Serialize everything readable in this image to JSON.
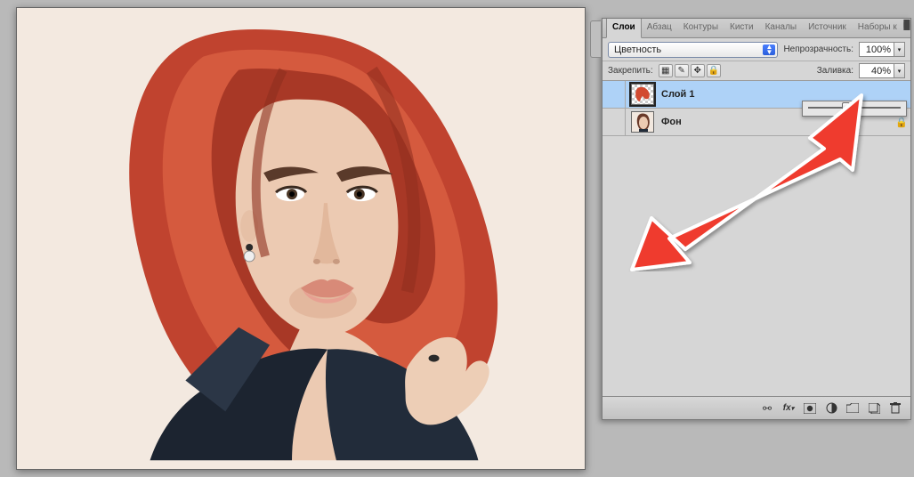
{
  "panel": {
    "tabs": [
      "Слои",
      "Абзац",
      "Контуры",
      "Кисти",
      "Каналы",
      "Источник",
      "Наборы к"
    ],
    "active_tab": 0,
    "blend_mode": "Цветность",
    "opacity_label": "Непрозрачность:",
    "opacity_value": "100%",
    "lock_label": "Закрепить:",
    "fill_label": "Заливка:",
    "fill_value": "40%",
    "fill_slider_pct": 40
  },
  "layers": [
    {
      "name": "Слой 1",
      "visible": true,
      "selected": true,
      "locked": false,
      "thumb": "redhair"
    },
    {
      "name": "Фон",
      "visible": true,
      "selected": false,
      "locked": true,
      "thumb": "portrait"
    }
  ],
  "footer_icons": [
    "link-icon",
    "fx-icon",
    "mask-icon",
    "adjustment-icon",
    "group-icon",
    "new-layer-icon",
    "trash-icon"
  ],
  "lock_icons": [
    "lock-transparency-icon",
    "lock-paint-icon",
    "lock-move-icon",
    "lock-all-icon"
  ],
  "accent_red": "#ef3b2e"
}
